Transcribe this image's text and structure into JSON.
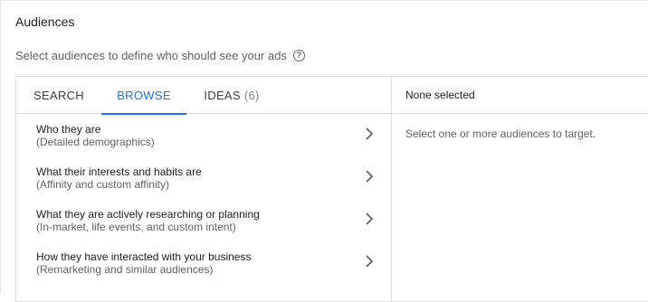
{
  "header": {
    "title": "Audiences",
    "subtitle": "Select audiences to define who should see your ads",
    "help_icon": "?"
  },
  "tabs": [
    {
      "label": "SEARCH",
      "active": false
    },
    {
      "label": "BROWSE",
      "active": true
    },
    {
      "label": "IDEAS",
      "count": "(6)",
      "active": false
    }
  ],
  "browse_items": [
    {
      "title": "Who they are",
      "subtitle": "(Detailed demographics)"
    },
    {
      "title": "What their interests and habits are",
      "subtitle": "(Affinity and custom affinity)"
    },
    {
      "title": "What they are actively researching or planning",
      "subtitle": "(In-market, life events, and custom intent)"
    },
    {
      "title": "How they have interacted with your business",
      "subtitle": "(Remarketing and similar audiences)"
    }
  ],
  "selection": {
    "header": "None selected",
    "empty_message": "Select one or more audiences to target."
  },
  "colors": {
    "accent": "#1a73e8",
    "border": "#dadce0",
    "secondary_text": "#5f6368"
  }
}
